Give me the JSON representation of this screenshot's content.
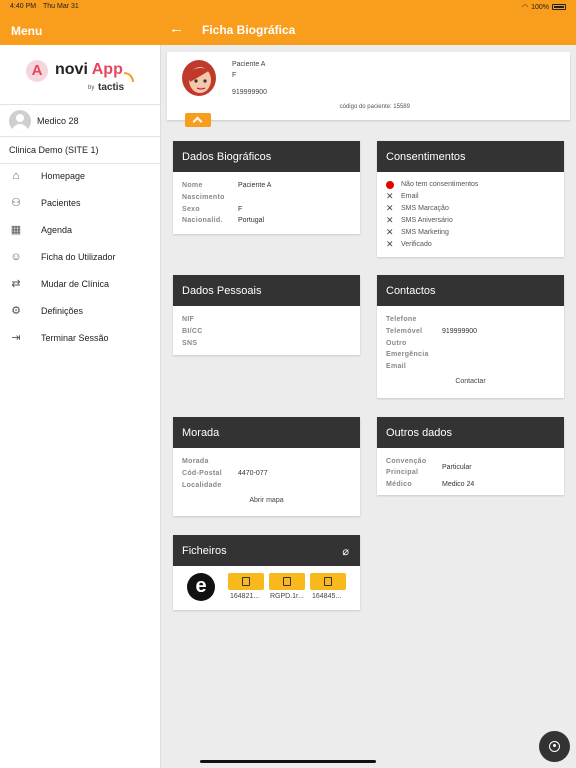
{
  "status_bar": {
    "time": "4:40 PM",
    "date": "Thu Mar 31",
    "battery": "100%"
  },
  "sidebar": {
    "title": "Menu",
    "logo": {
      "badge": "A",
      "brand_a": "novi ",
      "brand_b": "App",
      "by": "by",
      "tactis": "tactis"
    },
    "user_name": "Medico 28",
    "clinic": "Clinica Demo (SITE 1)",
    "items": [
      {
        "label": "Homepage",
        "icon": "home-icon"
      },
      {
        "label": "Pacientes",
        "icon": "users-icon"
      },
      {
        "label": "Agenda",
        "icon": "calendar-icon"
      },
      {
        "label": "Ficha do Utilizador",
        "icon": "user-icon"
      },
      {
        "label": "Mudar de Clínica",
        "icon": "swap-icon"
      },
      {
        "label": "Definições",
        "icon": "gear-icon"
      },
      {
        "label": "Terminar Sessão",
        "icon": "logout-icon"
      }
    ]
  },
  "header": {
    "title": "Ficha Biográfica"
  },
  "patient": {
    "name": "Paciente A",
    "sex": "F",
    "phone": "919999900",
    "code": "código do paciente: 15589"
  },
  "bio": {
    "title": "Dados Biográficos",
    "labels": {
      "name": "Nome",
      "birth": "Nascimento",
      "sex": "Sexo",
      "nationality": "Nacionalid."
    },
    "values": {
      "name": "Paciente A",
      "birth": "",
      "sex": "F",
      "nationality": "Portugal"
    }
  },
  "consent": {
    "title": "Consentimentos",
    "items": [
      {
        "text": "Não tem consentimentos",
        "status": "red-dot"
      },
      {
        "text": "Email",
        "status": "x"
      },
      {
        "text": "SMS Marcação",
        "status": "x"
      },
      {
        "text": "SMS Aniversário",
        "status": "x"
      },
      {
        "text": "SMS Marketing",
        "status": "x"
      },
      {
        "text": "Verificado",
        "status": "x"
      }
    ],
    "dot_color": "#e60000"
  },
  "personal": {
    "title": "Dados Pessoais",
    "labels": {
      "nif": "NIF",
      "bicc": "BI/CC",
      "sns": "SNS"
    }
  },
  "contacts": {
    "title": "Contactos",
    "labels": {
      "phone": "Telefone",
      "mobile": "Telemóvel",
      "other": "Outro",
      "emergency": "Emergência",
      "email": "Email"
    },
    "values": {
      "mobile": "919999900"
    },
    "action": "Contactar"
  },
  "address": {
    "title": "Morada",
    "labels": {
      "street": "Morada",
      "postal": "Cód-Postal",
      "locality": "Localidade"
    },
    "values": {
      "postal": "4470-077"
    },
    "action": "Abrir mapa"
  },
  "other": {
    "title": "Outros dados",
    "labels": {
      "convention_a": "Convenção",
      "convention_b": "Principal",
      "doctor": "Médico"
    },
    "values": {
      "convention": "Particular",
      "doctor": "Medico 24"
    }
  },
  "files": {
    "title": "Ficheiros",
    "logo_letter": "e",
    "items": [
      "164821...",
      "RGPD.1r...",
      "164845..."
    ]
  },
  "colors": {
    "accent": "#f99d1c",
    "card_header": "#333333",
    "file_button": "#f9b91c"
  }
}
